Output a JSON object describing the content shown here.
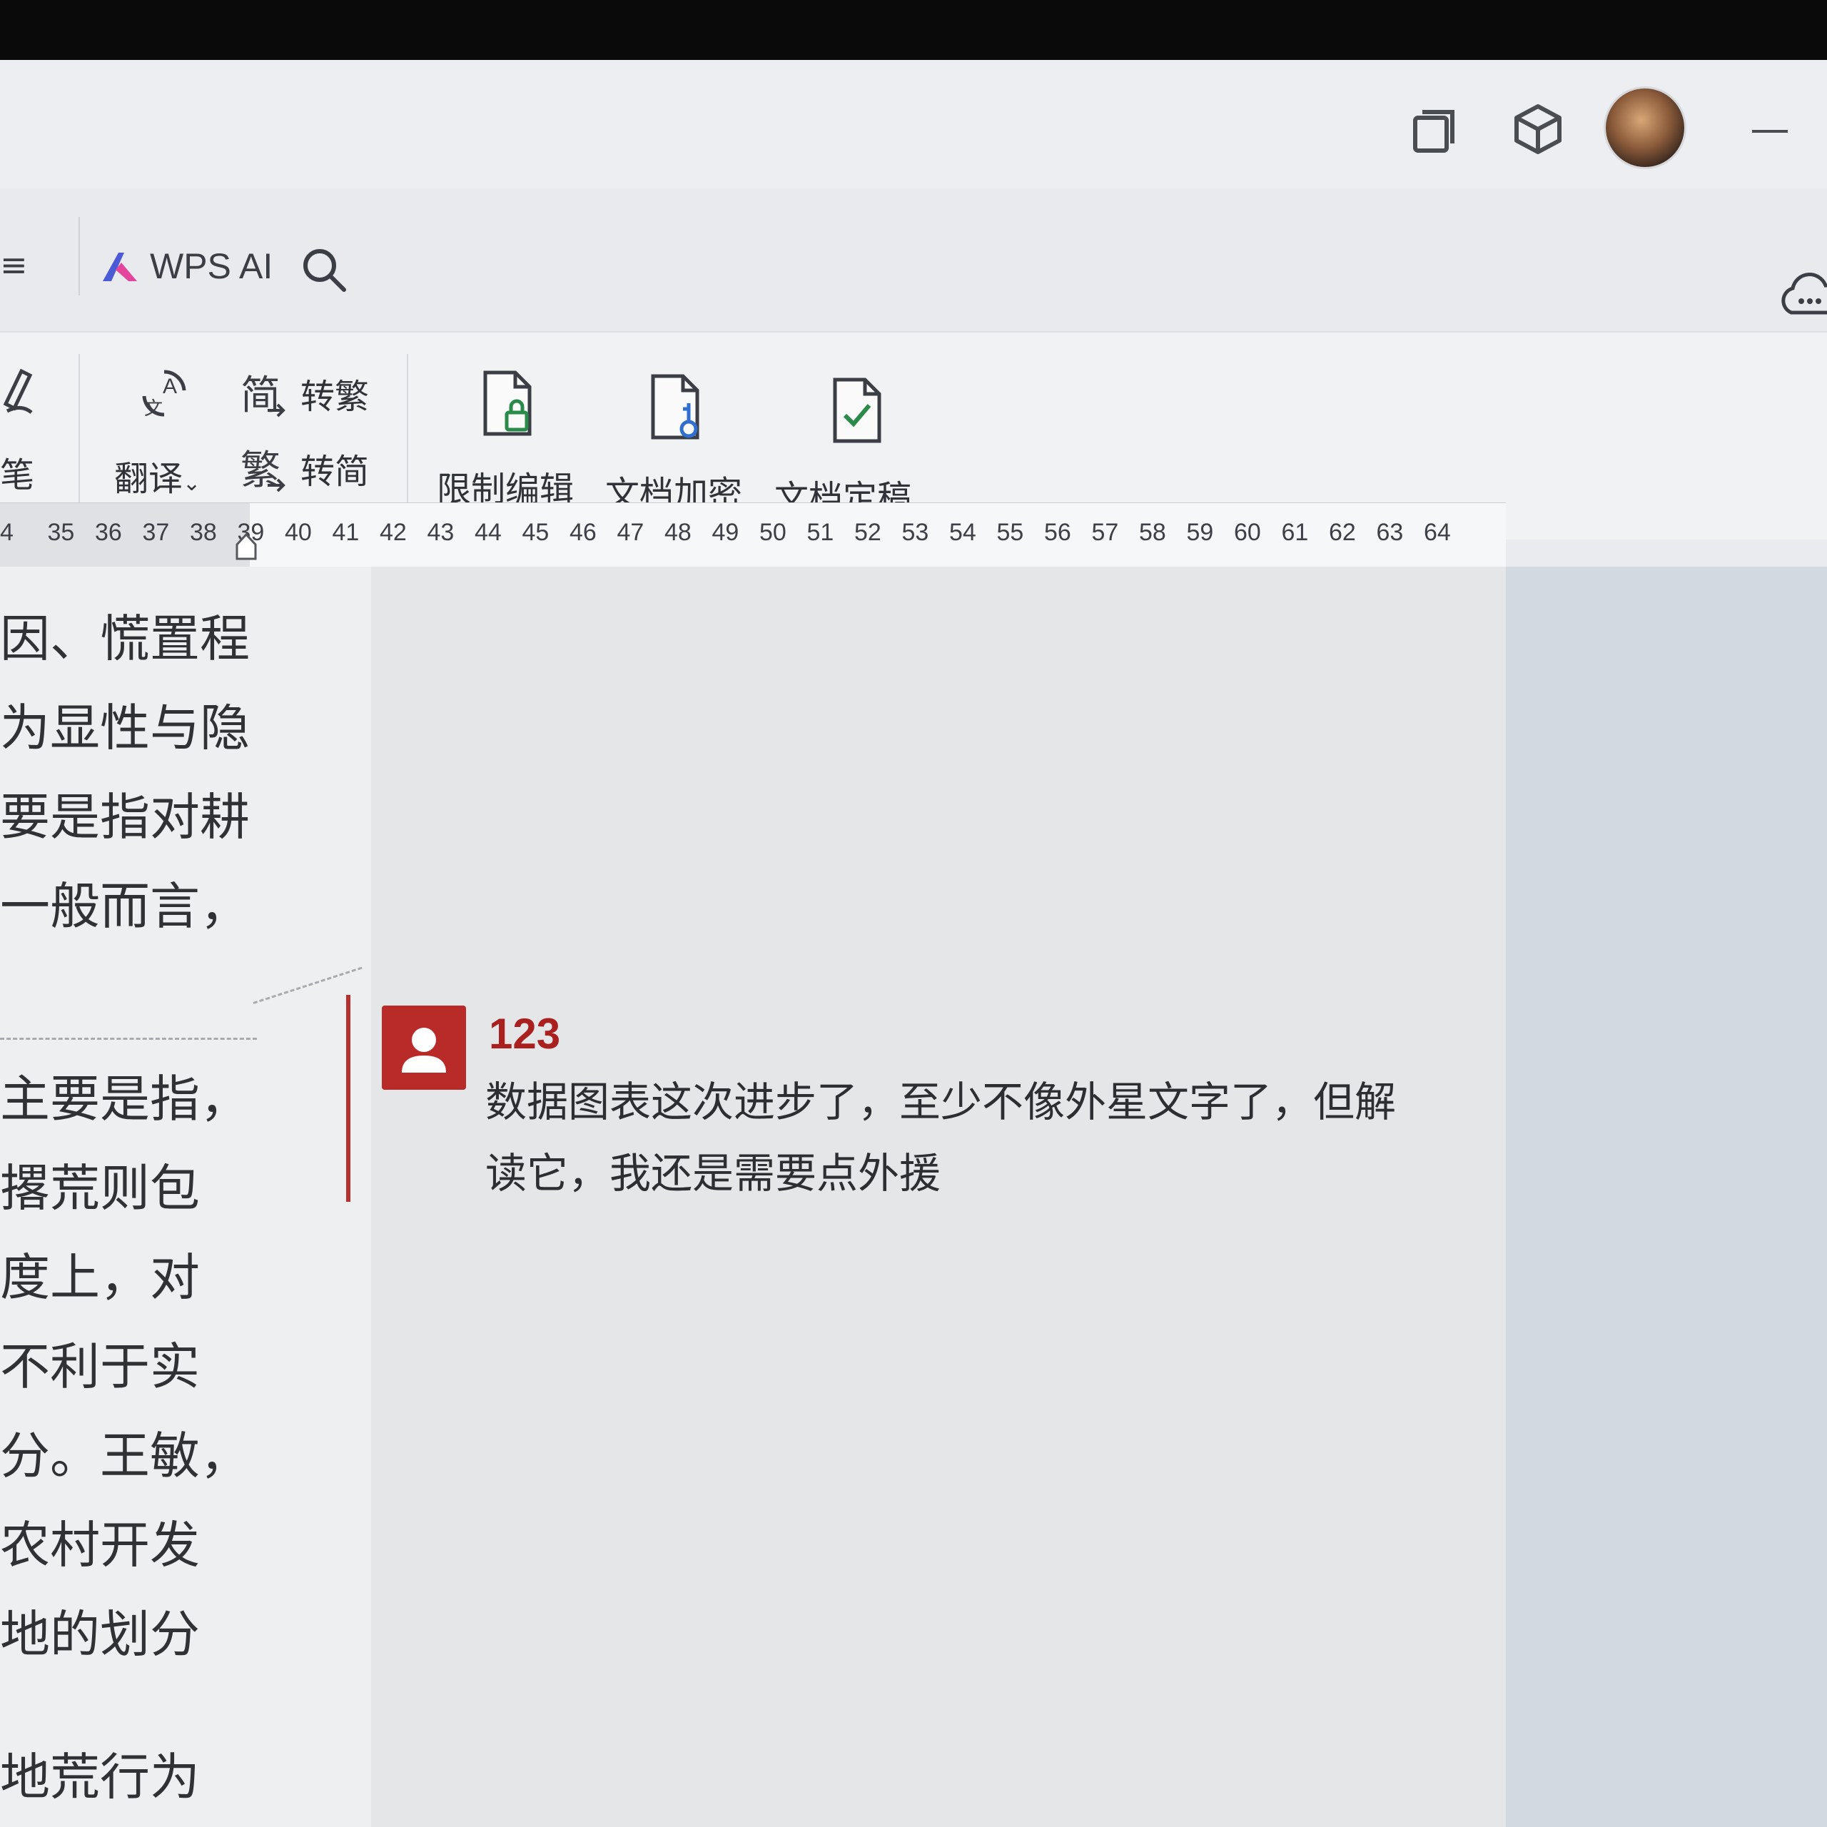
{
  "titlebar": {
    "icons": [
      "tab-restore-icon",
      "3d-box-icon",
      "user-avatar",
      "minimize-icon"
    ]
  },
  "menubar": {
    "left_fragment": "≡",
    "wps_ai_label": "WPS AI",
    "search_icon": "search-icon",
    "cloud_icon": "cloud-sync-icon"
  },
  "ribbon": {
    "pen_label": "笔",
    "translate_label": "翻译",
    "to_traditional_label": "转繁",
    "to_simplified_label": "转简",
    "restrict_edit_label": "限制编辑",
    "encrypt_label": "文档加密",
    "finalize_label": "文档定稿",
    "colors": {
      "accent": "#2a8a4a",
      "blue": "#2f6fd0"
    }
  },
  "ruler": {
    "ticks": [
      "4",
      "35",
      "36",
      "37",
      "38",
      "39",
      "40",
      "41",
      "42",
      "43",
      "44",
      "45",
      "46",
      "47",
      "48",
      "49",
      "50",
      "51",
      "52",
      "53",
      "54",
      "55",
      "56",
      "57",
      "58",
      "59",
      "60",
      "61",
      "62",
      "63",
      "64"
    ]
  },
  "document": {
    "lines_top": [
      "因、慌置程",
      "为显性与隐",
      "要是指对耕",
      "一般而言，"
    ],
    "lines_bottom": [
      "主要是指，",
      "撂荒则包",
      "度上，对",
      "不利于实",
      "分。王敏，",
      "农村开发",
      "地的划分"
    ],
    "line_last": "地荒行为"
  },
  "comment": {
    "user": "123",
    "text": "数据图表这次进步了，至少不像外星文字了，但解读它，我还是需要点外援",
    "accent": "#b92b28"
  }
}
